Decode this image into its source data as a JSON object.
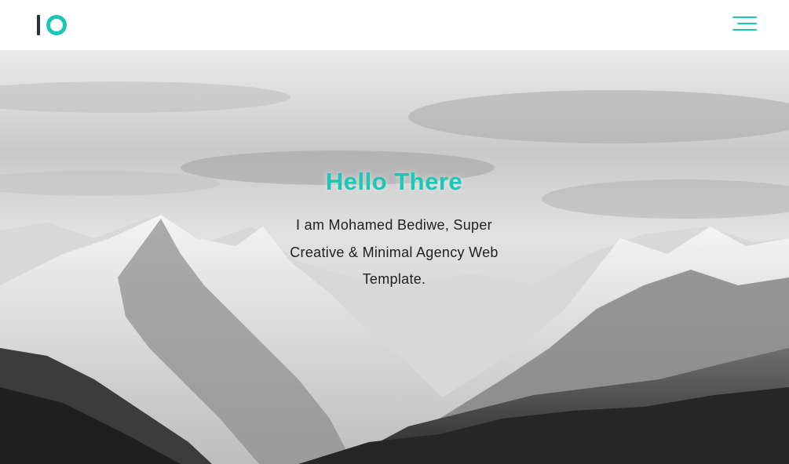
{
  "header": {
    "logo_icon": "io-logo-icon",
    "menu_icon": "hamburger-menu-icon"
  },
  "hero": {
    "title": "Hello There",
    "text": "I am Mohamed Bediwe, Super Creative & Minimal Agency Web Template."
  },
  "colors": {
    "accent": "#1cc8b5",
    "logo_dark": "#263238",
    "header_bg": "#ffffff"
  }
}
